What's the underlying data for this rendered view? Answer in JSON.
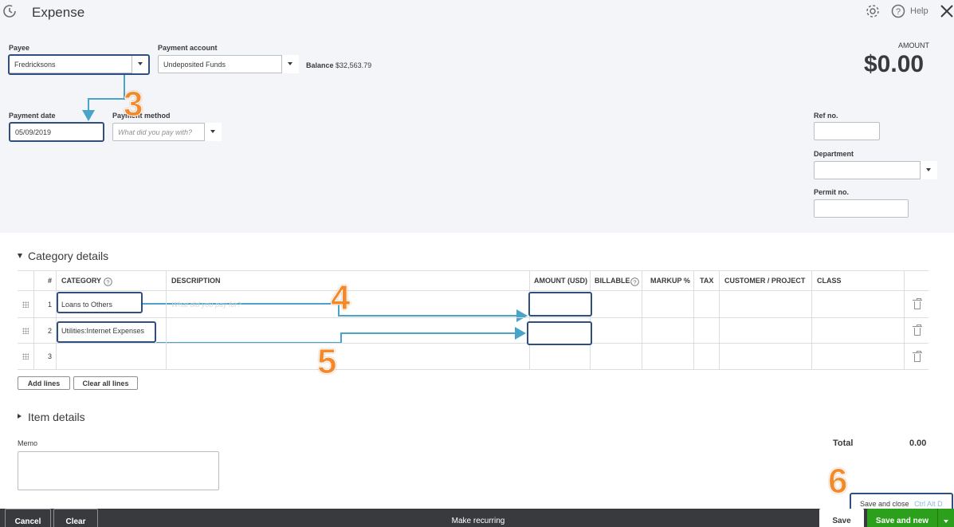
{
  "header": {
    "title": "Expense",
    "help_label": "Help"
  },
  "payee": {
    "label": "Payee",
    "value": "Fredricksons"
  },
  "payment_account": {
    "label": "Payment account",
    "value": "Undeposited Funds",
    "balance_label": "Balance",
    "balance_value": "$32,563.79"
  },
  "amount": {
    "label": "AMOUNT",
    "value": "$0.00"
  },
  "payment_date": {
    "label": "Payment date",
    "value": "05/09/2019"
  },
  "payment_method": {
    "label": "Payment method",
    "placeholder": "What did you pay with?"
  },
  "ref_no": {
    "label": "Ref no."
  },
  "department": {
    "label": "Department"
  },
  "permit_no": {
    "label": "Permit no."
  },
  "category_details": {
    "title": "Category details",
    "columns": [
      "#",
      "CATEGORY",
      "DESCRIPTION",
      "AMOUNT (USD)",
      "BILLABLE",
      "MARKUP %",
      "TAX",
      "CUSTOMER / PROJECT",
      "CLASS"
    ],
    "rows": [
      {
        "num": "1",
        "category": "Loans to Others",
        "description_placeholder": "What did you pay for?"
      },
      {
        "num": "2",
        "category": "Utilities:Internet Expenses"
      },
      {
        "num": "3",
        "category": ""
      }
    ],
    "add_lines": "Add lines",
    "clear_all_lines": "Clear all lines"
  },
  "item_details": {
    "title": "Item details"
  },
  "memo": {
    "label": "Memo"
  },
  "total": {
    "label": "Total",
    "value": "0.00"
  },
  "annotations": {
    "step3": "3",
    "step4": "4",
    "step5": "5",
    "step6": "6"
  },
  "save_menu": {
    "label": "Save and close",
    "shortcut": "Ctrl Alt D"
  },
  "footer": {
    "cancel": "Cancel",
    "clear": "Clear",
    "make_recurring": "Make recurring",
    "save": "Save",
    "save_and_new": "Save and new"
  },
  "colors": {
    "primary_green": "#2ca01c",
    "footer_bg": "#393a3d",
    "annotation_orange": "#f28a2b",
    "highlight_blue": "#2f4f7f",
    "arrow_teal": "#4aa3c8"
  }
}
